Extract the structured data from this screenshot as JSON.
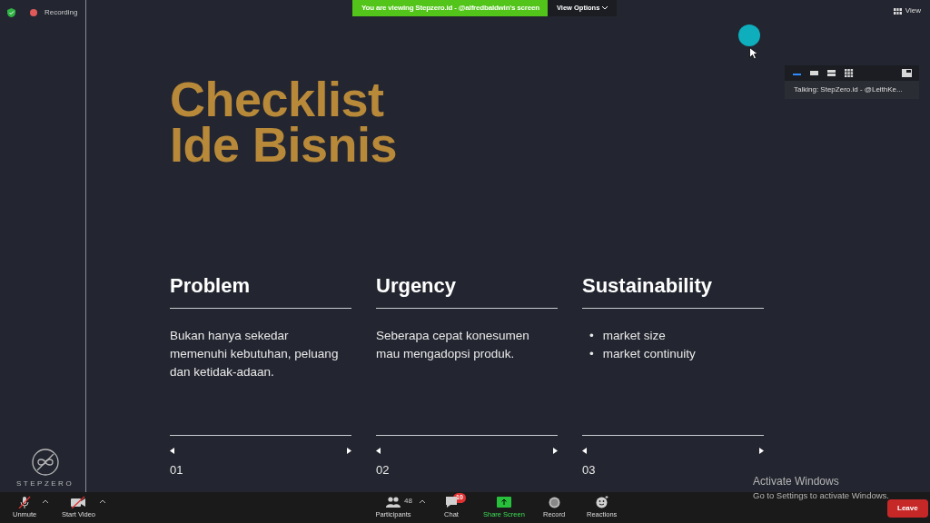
{
  "status": {
    "recording_label": "Recording"
  },
  "share_banner": {
    "text": "You are viewing Stepzero.id - @alfredbaldwin's screen",
    "view_options": "View Options"
  },
  "view_button": "View",
  "speaker_panel": {
    "layouts": [
      {
        "selected": true
      },
      {
        "selected": false
      },
      {
        "selected": false
      },
      {
        "selected": false
      }
    ],
    "talking": "Talking: StepZero.id - @LeithKe..."
  },
  "slide": {
    "title_lines": [
      "Checklist",
      "Ide Bisnis"
    ],
    "columns": [
      {
        "heading": "Problem",
        "kind": "text",
        "text": "Bukan hanya sekedar memenuhi kebutuhan, peluang dan ketidak-adaan.",
        "number": "01"
      },
      {
        "heading": "Urgency",
        "kind": "text",
        "text": "Seberapa cepat konesumen mau mengadopsi produk.",
        "number": "02"
      },
      {
        "heading": "Sustainability",
        "kind": "bullets",
        "bullets": [
          {
            "marker": "•",
            "text": "market size"
          },
          {
            "marker": "•",
            "text": "market continuity"
          }
        ],
        "number": "03"
      }
    ],
    "logo_text": "STEPZERO"
  },
  "activation": {
    "title": "Activate Windows",
    "subtitle": "Go to Settings to activate Windows."
  },
  "toolbar": {
    "left": [
      {
        "kind": "mic",
        "label": "Unmute",
        "off": true
      },
      {
        "kind": "video",
        "label": "Start Video",
        "off": true
      }
    ],
    "center": [
      {
        "kind": "participants",
        "label": "Participants",
        "count": "48"
      },
      {
        "kind": "chat",
        "label": "Chat",
        "badge": "10"
      },
      {
        "kind": "share",
        "label": "Share Screen"
      },
      {
        "kind": "record",
        "label": "Record"
      },
      {
        "kind": "reactions",
        "label": "Reactions"
      }
    ],
    "leave": "Leave"
  }
}
